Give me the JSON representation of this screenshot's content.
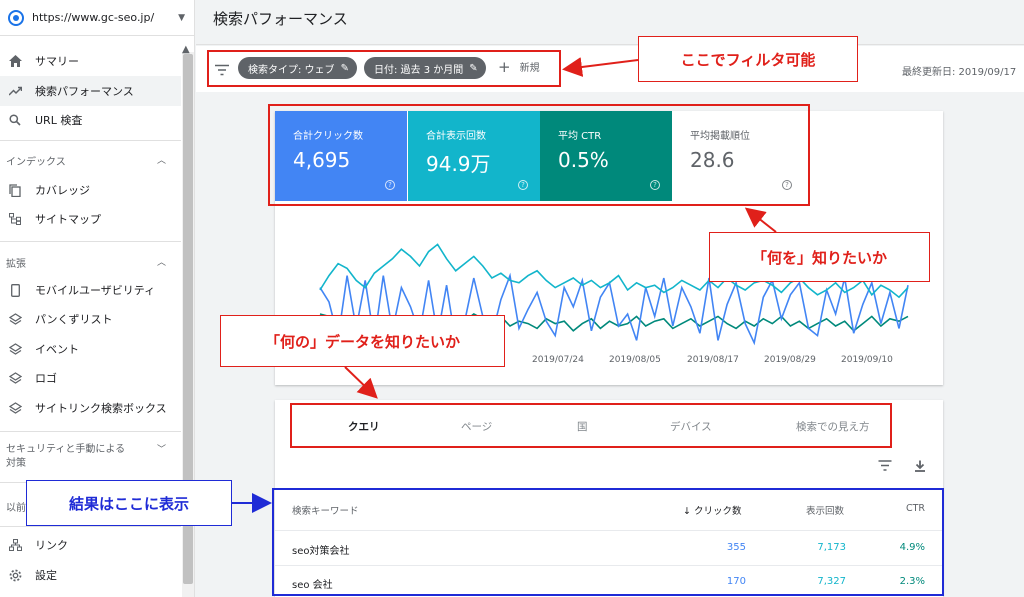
{
  "sidebar": {
    "property_url": "https://www.gc-seo.jp/",
    "items": [
      {
        "label": "サマリー",
        "icon": "home-icon"
      },
      {
        "label": "検索パフォーマンス",
        "icon": "trending-icon"
      },
      {
        "label": "URL 検査",
        "icon": "search-icon"
      }
    ],
    "sections": [
      {
        "title": "インデックス",
        "items": [
          "カバレッジ",
          "サイトマップ"
        ]
      },
      {
        "title": "拡張",
        "items": [
          "モバイルユーザビリティ",
          "パンくずリスト",
          "イベント",
          "ロゴ",
          "サイトリンク検索ボックス"
        ]
      },
      {
        "title_line1": "セキュリティと手動による",
        "title_line2": "対策"
      },
      {
        "title": "以前"
      }
    ],
    "bottom_items": [
      "リンク",
      "設定"
    ]
  },
  "header": {
    "title": "検索パフォーマンス"
  },
  "filters": {
    "chip1": "検索タイプ: ウェブ",
    "chip2": "日付: 過去 3 か月間",
    "new_label": "新規",
    "updated": "最終更新日: 2019/09/17"
  },
  "metrics": [
    {
      "label": "合計クリック数",
      "value": "4,695"
    },
    {
      "label": "合計表示回数",
      "value": "94.9万"
    },
    {
      "label": "平均 CTR",
      "value": "0.5%"
    },
    {
      "label": "平均掲載順位",
      "value": "28.6"
    }
  ],
  "chart_data": {
    "type": "line",
    "x_tick_labels": [
      "2019/07/24",
      "2019/08/05",
      "2019/08/17",
      "2019/08/29",
      "2019/09/10"
    ],
    "series": [
      {
        "name": "合計クリック数",
        "color": "#4285f4",
        "values": [
          52,
          40,
          10,
          62,
          18,
          58,
          8,
          62,
          16,
          52,
          36,
          14,
          58,
          12,
          54,
          6,
          24,
          60,
          28,
          12,
          42,
          62,
          18,
          34,
          48,
          24,
          12,
          52,
          36,
          58,
          16,
          44,
          56,
          20,
          30,
          8,
          52,
          28,
          60,
          20,
          52,
          36,
          14,
          60,
          8,
          38,
          56,
          22,
          6,
          44,
          58,
          26,
          46,
          56,
          18,
          12,
          50,
          30,
          60,
          14,
          38,
          56,
          22,
          48,
          18,
          54
        ]
      },
      {
        "name": "合計表示回数",
        "color": "#12b5cb",
        "values": [
          50,
          62,
          72,
          68,
          58,
          52,
          64,
          70,
          76,
          84,
          78,
          70,
          82,
          88,
          76,
          66,
          72,
          78,
          70,
          60,
          64,
          58,
          56,
          62,
          66,
          58,
          52,
          56,
          60,
          54,
          58,
          52,
          56,
          62,
          50,
          56,
          52,
          54,
          48,
          52,
          58,
          54,
          50,
          58,
          52,
          60,
          54,
          50,
          56,
          58,
          54,
          48,
          56,
          60,
          52,
          46,
          50,
          56,
          48,
          52,
          58,
          46,
          54,
          50,
          44,
          52
        ]
      },
      {
        "name": "平均 CTR",
        "color": "#00897b",
        "values": [
          30,
          28,
          26,
          28,
          22,
          26,
          20,
          24,
          26,
          22,
          24,
          28,
          22,
          26,
          18,
          20,
          24,
          30,
          26,
          22,
          28,
          20,
          24,
          22,
          18,
          26,
          22,
          24,
          16,
          22,
          26,
          18,
          24,
          20,
          22,
          28,
          20,
          24,
          26,
          18,
          22,
          26,
          20,
          24,
          28,
          22,
          18,
          24,
          20,
          26,
          22,
          28,
          20,
          24,
          18,
          22,
          26,
          20,
          24,
          16,
          22,
          28,
          20,
          26,
          24,
          28
        ]
      }
    ]
  },
  "tabs": [
    "クエリ",
    "ページ",
    "国",
    "デバイス",
    "検索での見え方"
  ],
  "table": {
    "headers": [
      "検索キーワード",
      "クリック数",
      "表示回数",
      "CTR"
    ],
    "sort_arrow": "↓",
    "rows": [
      {
        "keyword": "seo対策会社",
        "clicks": "355",
        "impressions": "7,173",
        "ctr": "4.9%"
      },
      {
        "keyword": "seo 会社",
        "clicks": "170",
        "impressions": "7,327",
        "ctr": "2.3%"
      }
    ]
  },
  "annotations": {
    "filter_note": "ここでフィルタ可能",
    "what_note": "「何を」知りたいか",
    "which_note": "「何の」データを知りたいか",
    "result_note": "結果はここに表示"
  },
  "colors": {
    "red": "#e0201a",
    "blue": "#1f2bd6",
    "clicks": "#4285f4",
    "impressions": "#12b5cb",
    "ctr": "#00897b"
  }
}
